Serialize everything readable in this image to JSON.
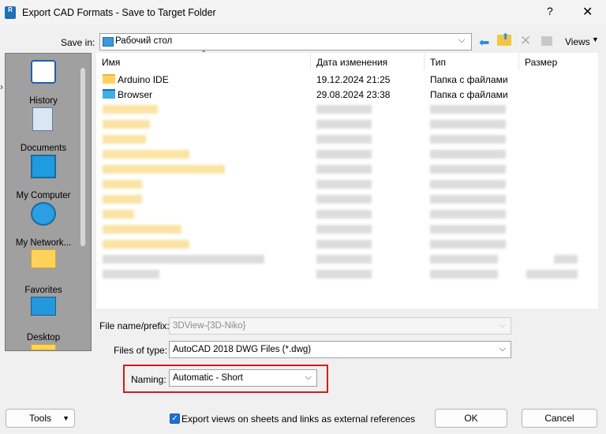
{
  "window": {
    "title": "Export CAD Formats - Save to Target Folder",
    "help_glyph": "?",
    "close_glyph": "✕",
    "app_icon_text": "R"
  },
  "save_in": {
    "label": "Save in:",
    "value": "Рабочий стол",
    "views_label": "Views"
  },
  "places": [
    {
      "label": "History",
      "icon": "history-icon"
    },
    {
      "label": "Documents",
      "icon": "documents-icon"
    },
    {
      "label": "My Computer",
      "icon": "computer-icon"
    },
    {
      "label": "My Network...",
      "icon": "network-icon"
    },
    {
      "label": "Favorites",
      "icon": "folder-icon"
    },
    {
      "label": "Desktop",
      "icon": "desktop-icon"
    }
  ],
  "file_list": {
    "columns": [
      "Имя",
      "Дата изменения",
      "Тип",
      "Размер"
    ],
    "rows": [
      {
        "name": "Arduino IDE",
        "date": "19.12.2024 21:25",
        "type": "Папка с файлами",
        "icon": "folder-icon"
      },
      {
        "name": "Browser",
        "date": "29.08.2024 23:38",
        "type": "Папка с файлами",
        "icon": "monitor-folder-icon"
      }
    ]
  },
  "form": {
    "file_name_label": "File name/prefix:",
    "file_name_value": "3DView-{3D-Niko}",
    "file_type_label": "Files of type:",
    "file_type_value": "AutoCAD 2018 DWG Files (*.dwg)",
    "naming_label": "Naming:",
    "naming_value": "Automatic - Short"
  },
  "footer": {
    "tools_label": "Tools",
    "export_checkbox_label": "Export views on sheets and links as external references",
    "export_checked": true,
    "ok_label": "OK",
    "cancel_label": "Cancel"
  },
  "colors": {
    "accent": "#1e6fd0",
    "highlight_border": "#d01c1c"
  }
}
